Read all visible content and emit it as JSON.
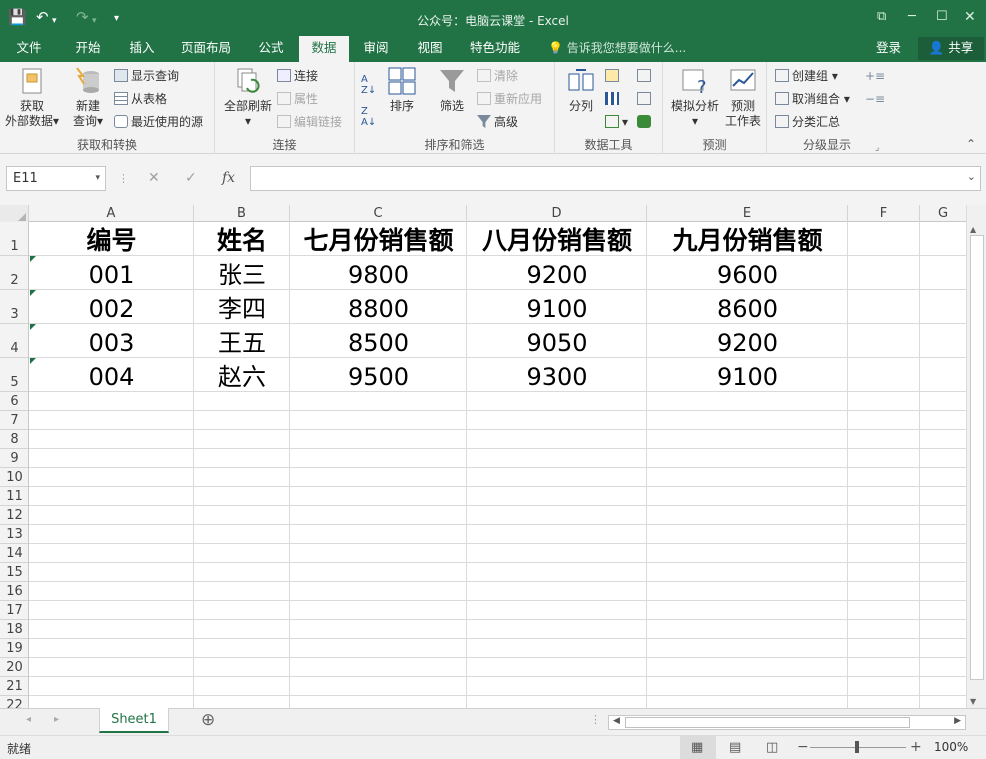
{
  "titlebar": {
    "title": "公众号：电脑云课堂 - Excel",
    "save_icon": "💾",
    "undo_icon": "↶",
    "redo_icon": "↷",
    "customize_icon": "▾"
  },
  "tabs": [
    "文件",
    "开始",
    "插入",
    "页面布局",
    "公式",
    "数据",
    "审阅",
    "视图",
    "特色功能"
  ],
  "active_tab": "数据",
  "tellme": "告诉我您想要做什么...",
  "login": "登录",
  "share": "共享",
  "ribbon": {
    "get_transform": {
      "label": "获取和转换",
      "get_external_l1": "获取",
      "get_external_l2": "外部数据",
      "new_query_l1": "新建",
      "new_query_l2": "查询",
      "show_queries": "显示查询",
      "from_table": "从表格",
      "recent_sources": "最近使用的源"
    },
    "connections": {
      "label": "连接",
      "refresh_all": "全部刷新",
      "connections": "连接",
      "properties": "属性",
      "edit_links": "编辑链接"
    },
    "sort_filter": {
      "label": "排序和筛选",
      "sort": "排序",
      "filter": "筛选",
      "clear": "清除",
      "reapply": "重新应用",
      "advanced": "高级"
    },
    "data_tools": {
      "label": "数据工具",
      "text_to_columns": "分列"
    },
    "forecast": {
      "label": "预测",
      "what_if": "模拟分析",
      "forecast_sheet_l1": "预测",
      "forecast_sheet_l2": "工作表"
    },
    "outline": {
      "label": "分级显示",
      "group": "创建组",
      "ungroup": "取消组合",
      "subtotal": "分类汇总"
    }
  },
  "formula_bar": {
    "name_box": "E11",
    "cancel": "✕",
    "enter": "✓",
    "fx": "fx",
    "formula": ""
  },
  "columns": [
    "A",
    "B",
    "C",
    "D",
    "E",
    "F",
    "G"
  ],
  "rows": [
    "1",
    "2",
    "3",
    "4",
    "5",
    "6",
    "7",
    "8",
    "9",
    "10",
    "11",
    "12",
    "13",
    "14",
    "15",
    "16",
    "17",
    "18",
    "19",
    "20",
    "21",
    "22"
  ],
  "cells": {
    "header": [
      "编号",
      "姓名",
      "七月份销售额",
      "八月份销售额",
      "九月份销售额"
    ],
    "data": [
      [
        "001",
        "张三",
        "9800",
        "9200",
        "9600"
      ],
      [
        "002",
        "李四",
        "8800",
        "9100",
        "8600"
      ],
      [
        "003",
        "王五",
        "8500",
        "9050",
        "9200"
      ],
      [
        "004",
        "赵六",
        "9500",
        "9300",
        "9100"
      ]
    ]
  },
  "sheet_tab": "Sheet1",
  "add_sheet": "⊕",
  "status": {
    "ready": "就绪",
    "zoom_minus": "−",
    "zoom_plus": "+",
    "zoom": "100%"
  }
}
